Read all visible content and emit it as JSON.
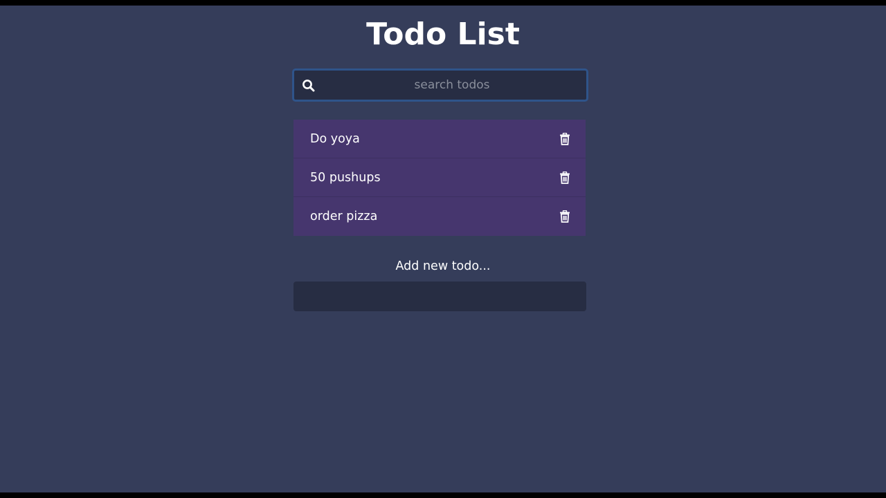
{
  "app": {
    "title": "Todo List"
  },
  "search": {
    "placeholder": "search todos",
    "value": "",
    "icon": "search-icon"
  },
  "todos": [
    {
      "text": "Do yoya",
      "delete_icon": "trash-icon"
    },
    {
      "text": "50 pushups",
      "delete_icon": "trash-icon"
    },
    {
      "text": "order pizza",
      "delete_icon": "trash-icon"
    }
  ],
  "add_form": {
    "label": "Add new todo...",
    "value": ""
  },
  "colors": {
    "background": "#353d5a",
    "input_background": "#272d43",
    "todo_item_background": "#46366e",
    "search_focus_border": "#2f548a",
    "text": "#ffffff",
    "placeholder_text": "#8a8f9c"
  }
}
